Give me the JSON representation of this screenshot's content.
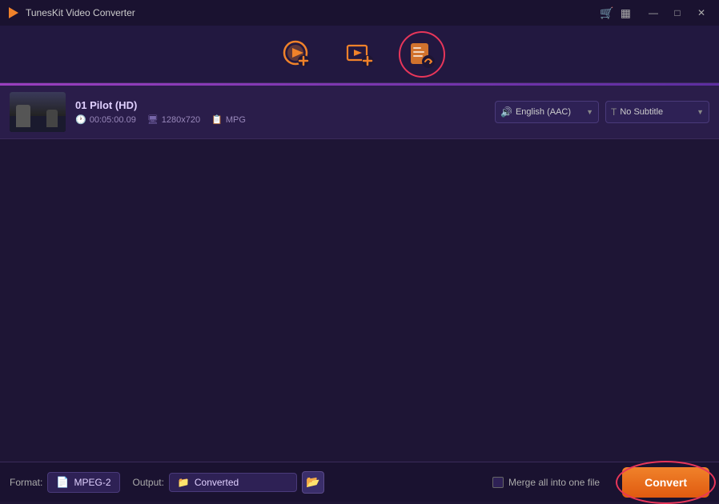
{
  "app": {
    "title": "TunesKit Video Converter",
    "logo_symbol": "▶"
  },
  "window_controls": {
    "cart_icon": "🛒",
    "grid_icon": "▦",
    "minimize": "—",
    "maximize": "□",
    "close": "✕"
  },
  "toolbar": {
    "tabs": [
      {
        "id": "add-video",
        "label": "Add Video",
        "active": false
      },
      {
        "id": "add-blu-ray",
        "label": "Add Blu-ray",
        "active": false
      },
      {
        "id": "convert",
        "label": "Convert",
        "active": true
      }
    ]
  },
  "file_list": [
    {
      "name": "01 Pilot (HD)",
      "duration": "00:05:00.09",
      "resolution": "1280x720",
      "format": "MPG",
      "audio": "English (AAC)",
      "subtitle": "No Subtitle"
    }
  ],
  "audio_dropdown": {
    "label": "English (AAC)",
    "icon": "🔊"
  },
  "subtitle_dropdown": {
    "label": "No Subtitle",
    "icon": "T"
  },
  "status_bar": {
    "format_label": "Format:",
    "format_value": "MPEG-2",
    "format_icon": "📄",
    "output_label": "Output:",
    "output_value": "Converted",
    "output_icon": "📁",
    "merge_label": "Merge all into one file",
    "convert_label": "Convert"
  }
}
